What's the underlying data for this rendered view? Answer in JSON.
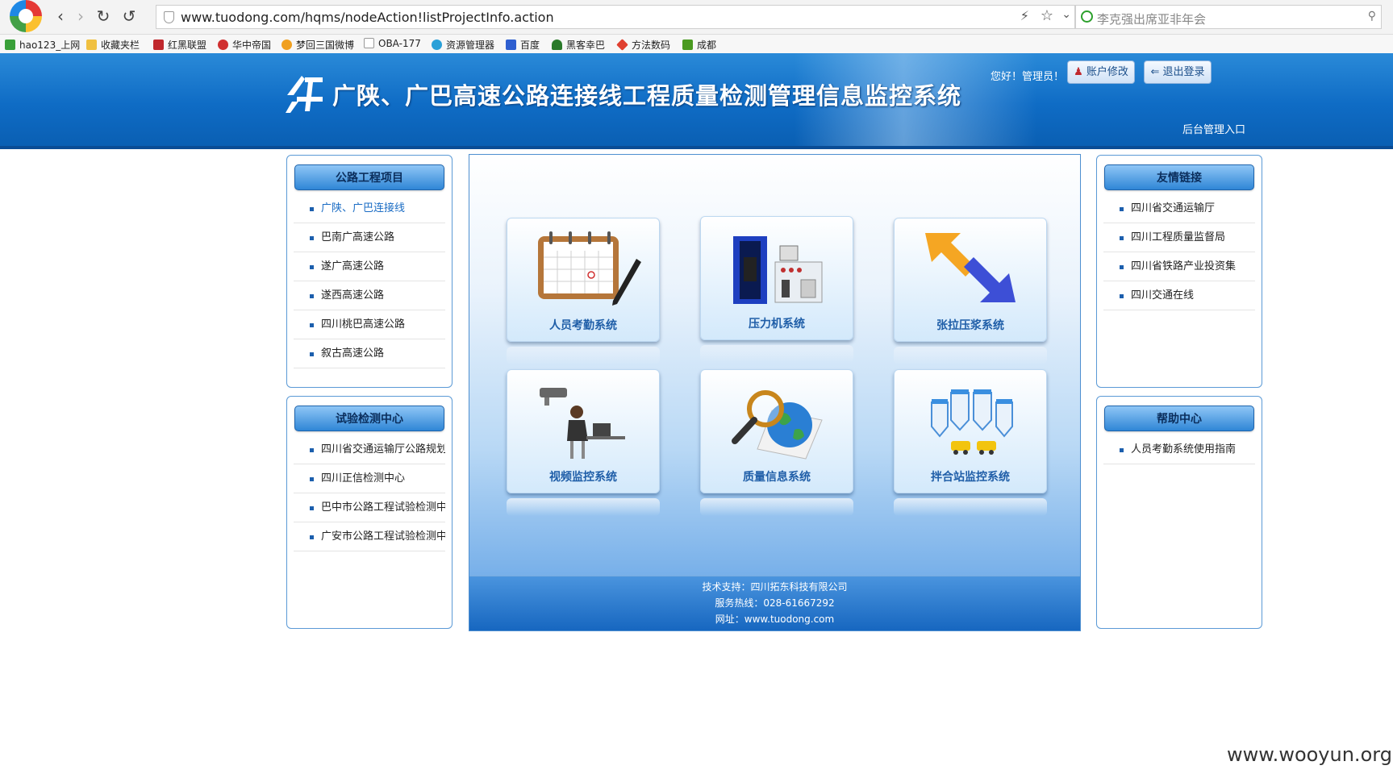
{
  "browser": {
    "url": "www.tuodong.com/hqms/nodeAction!listProjectInfo.action",
    "search_placeholder": "李克强出席亚非年会",
    "bookmarks": [
      "hao123_上网",
      "收藏夹栏",
      "红黑联盟",
      "华中帝国",
      "梦回三国微博",
      "OBA-177",
      "资源管理器",
      "百度",
      "黑客幸巴",
      "方法数码",
      "成都"
    ]
  },
  "header": {
    "title": "广陕、广巴高速公路连接线工程质量检测管理信息监控系统",
    "greeting": "您好！管理员！",
    "account_button": "账户修改",
    "logout_button": "退出登录",
    "admin_link": "后台管理入口"
  },
  "left_panels": {
    "projects": {
      "title": "公路工程项目",
      "items": [
        "广陕、广巴连接线",
        "巴南广高速公路",
        "遂广高速公路",
        "遂西高速公路",
        "四川桃巴高速公路",
        "叙古高速公路"
      ]
    },
    "testing": {
      "title": "试验检测中心",
      "items": [
        "四川省交通运输厅公路规划",
        "四川正信检测中心",
        "巴中市公路工程试验检测中",
        "广安市公路工程试验检测中"
      ]
    }
  },
  "right_panels": {
    "links": {
      "title": "友情链接",
      "items": [
        "四川省交通运输厅",
        "四川工程质量监督局",
        "四川省铁路产业投资集",
        "四川交通在线"
      ]
    },
    "help": {
      "title": "帮助中心",
      "items": [
        "人员考勤系统使用指南"
      ]
    }
  },
  "systems": [
    {
      "label": "人员考勤系统",
      "icon": "calendar-pen-icon"
    },
    {
      "label": "压力机系统",
      "icon": "press-machine-icon"
    },
    {
      "label": "张拉压浆系统",
      "icon": "arrows-icon"
    },
    {
      "label": "视频监控系统",
      "icon": "camera-operator-icon"
    },
    {
      "label": "质量信息系统",
      "icon": "magnifier-globe-icon"
    },
    {
      "label": "拌合站监控系统",
      "icon": "mixing-station-icon"
    }
  ],
  "footer": {
    "support": "技术支持：四川拓东科技有限公司",
    "hotline": "服务热线：028-61667292",
    "website": "网址：www.tuodong.com"
  },
  "watermark": "www.wooyun.org",
  "colors": {
    "header_blue": "#0f6cc5",
    "panel_border": "#5b9ad6",
    "label_blue": "#1f5ea8"
  }
}
